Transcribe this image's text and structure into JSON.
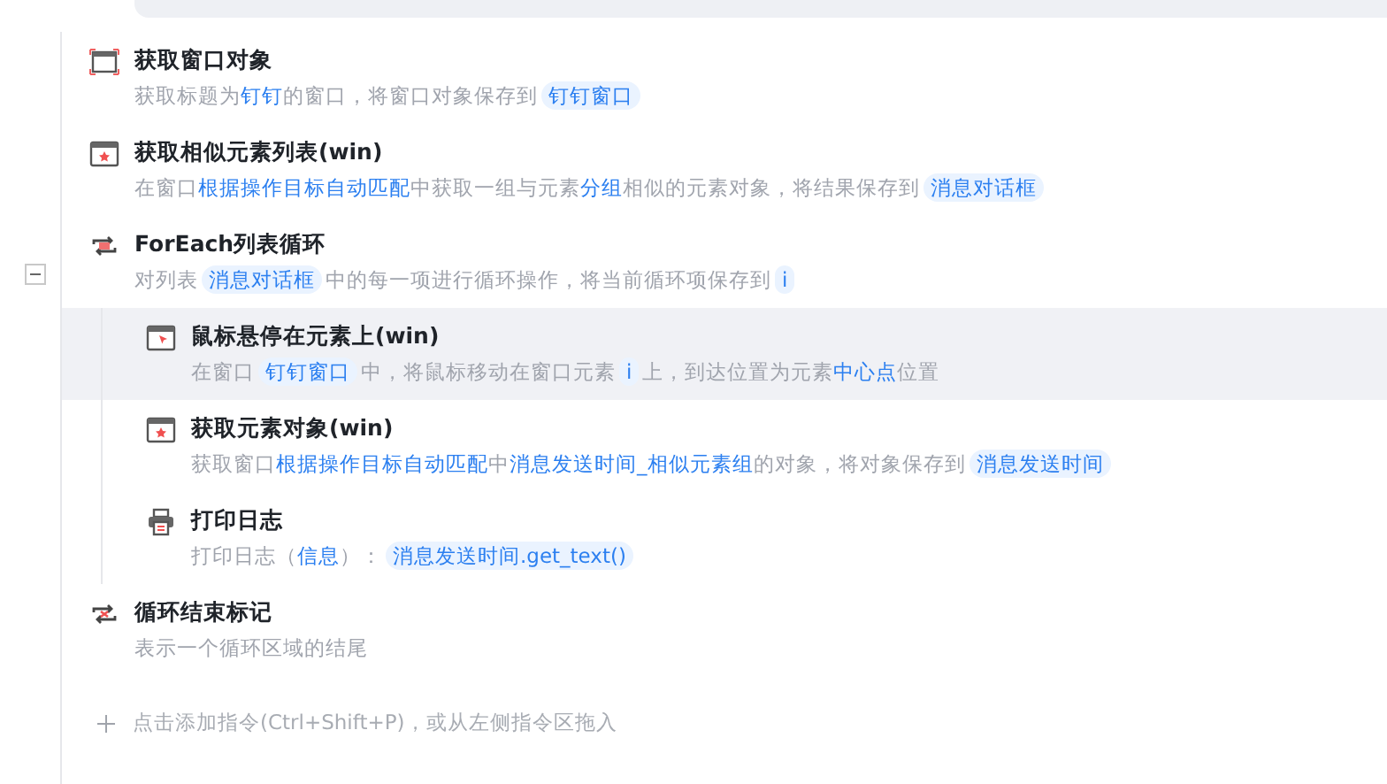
{
  "steps": [
    {
      "kind": "window",
      "title": "获取窗口对象",
      "selected": false,
      "description": [
        {
          "kind": "text",
          "text": "获取标题为"
        },
        {
          "kind": "link",
          "text": "钉钉"
        },
        {
          "kind": "text",
          "text": "的窗口，将窗口对象保存到"
        },
        {
          "kind": "var",
          "text": "钉钉窗口"
        }
      ]
    },
    {
      "kind": "element",
      "title": "获取相似元素列表(win)",
      "selected": false,
      "description": [
        {
          "kind": "text",
          "text": "在窗口"
        },
        {
          "kind": "link",
          "text": "根据操作目标自动匹配"
        },
        {
          "kind": "text",
          "text": "中获取一组与元素"
        },
        {
          "kind": "link",
          "text": "分组"
        },
        {
          "kind": "text",
          "text": "相似的元素对象，将结果保存到"
        },
        {
          "kind": "var",
          "text": "消息对话框"
        }
      ]
    },
    {
      "kind": "loop",
      "title": "ForEach列表循环",
      "selected": false,
      "expanded": true,
      "description": [
        {
          "kind": "text",
          "text": "对列表"
        },
        {
          "kind": "var",
          "text": "消息对话框"
        },
        {
          "kind": "text",
          "text": "中的每一项进行循环操作，将当前循环项保存到"
        },
        {
          "kind": "var",
          "text": "i"
        }
      ],
      "children": [
        {
          "kind": "hover",
          "title": "鼠标悬停在元素上(win)",
          "selected": true,
          "description": [
            {
              "kind": "text",
              "text": "在窗口"
            },
            {
              "kind": "var",
              "text": "钉钉窗口"
            },
            {
              "kind": "text",
              "text": "中，将鼠标移动在窗口元素"
            },
            {
              "kind": "var",
              "text": "i"
            },
            {
              "kind": "text",
              "text": "上，到达位置为元素"
            },
            {
              "kind": "link",
              "text": "中心点"
            },
            {
              "kind": "text",
              "text": "位置"
            }
          ]
        },
        {
          "kind": "element",
          "title": "获取元素对象(win)",
          "selected": false,
          "description": [
            {
              "kind": "text",
              "text": "获取窗口"
            },
            {
              "kind": "link",
              "text": "根据操作目标自动匹配"
            },
            {
              "kind": "text",
              "text": "中"
            },
            {
              "kind": "link",
              "text": "消息发送时间_相似元素组"
            },
            {
              "kind": "text",
              "text": "的对象，将对象保存到"
            },
            {
              "kind": "var",
              "text": "消息发送时间"
            }
          ]
        },
        {
          "kind": "print",
          "title": "打印日志",
          "selected": false,
          "description": [
            {
              "kind": "text",
              "text": "打印日志（"
            },
            {
              "kind": "link",
              "text": "信息"
            },
            {
              "kind": "text",
              "text": "）："
            },
            {
              "kind": "var",
              "text": "消息发送时间.get_text()"
            }
          ]
        }
      ]
    },
    {
      "kind": "loopend",
      "title": "循环结束标记",
      "selected": false,
      "description": [
        {
          "kind": "text",
          "text": "表示一个循环区域的结尾"
        }
      ]
    }
  ],
  "add_hint": "点击添加指令(Ctrl+Shift+P)，或从左侧指令区拖入"
}
